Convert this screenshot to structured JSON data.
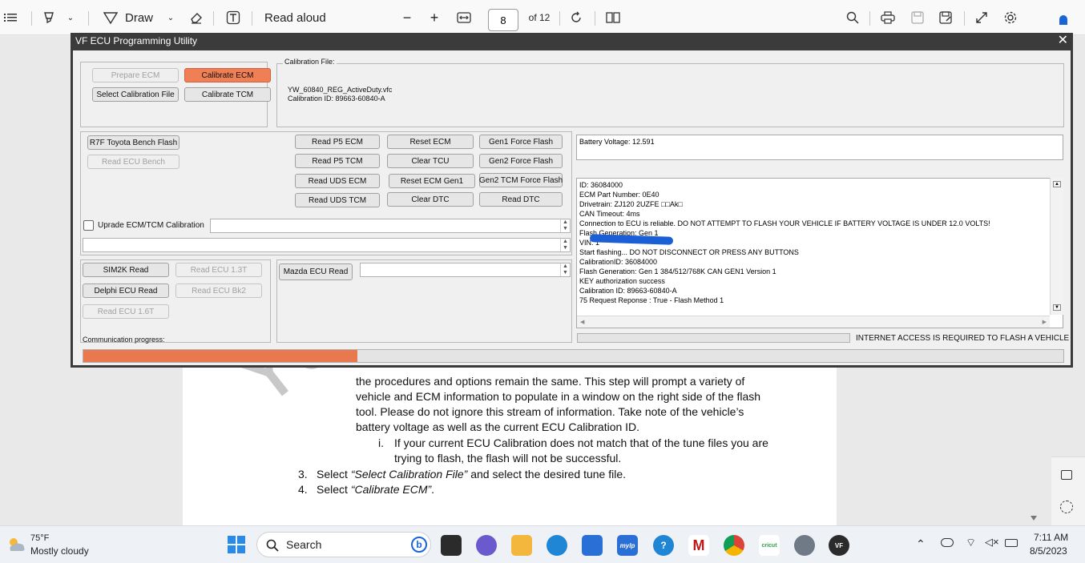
{
  "toolbar": {
    "draw_label": "Draw",
    "read_aloud_label": "Read aloud",
    "minus": "−",
    "plus": "+",
    "page_current": "8",
    "page_total": "of 12"
  },
  "pdf": {
    "watermark": "Yo",
    "lines": [
      "the procedures and options remain the same. This step will prompt a variety of",
      "vehicle and ECM information to populate in a window on the right side of the flash",
      "tool. Please do not ignore this stream of information. Take note of the vehicle’s",
      "battery voltage as well as the current ECU Calibration ID."
    ],
    "sub_marker": "i.",
    "sub_lines": [
      "If your current ECU Calibration does not match that of the tune files you are",
      "trying to flash, the flash will not be successful."
    ],
    "step3_num": "3.",
    "step3_pre": "Select ",
    "step3_em": "“Select Calibration File”",
    "step3_post": " and select the desired tune file.",
    "step4_num": "4.",
    "step4_pre": "Select ",
    "step4_em": "“Calibrate ECM”",
    "step4_post": "."
  },
  "dialog": {
    "title": "VF ECU Programming Utility",
    "close": "✕",
    "buttons": {
      "prepare_ecm": "Prepare ECM",
      "calibrate_ecm": "Calibrate ECM",
      "select_cal_file": "Select Calibration File",
      "calibrate_tcm": "Calibrate TCM",
      "r7f_flash": "R7F Toyota Bench Flash",
      "read_ecu_bench": "Read ECU Bench",
      "read_p5_ecm": "Read P5 ECM",
      "reset_ecm": "Reset ECM",
      "gen1_force": "Gen1 Force Flash",
      "read_p5_tcm": "Read P5 TCM",
      "clear_tcu": "Clear TCU",
      "gen2_force": "Gen2 Force Flash",
      "read_uds_ecm": "Read UDS ECM",
      "reset_ecm_gen1": "Reset ECM Gen1",
      "gen2_tcm_force": "Gen2 TCM Force Flash",
      "read_uds_tcm": "Read UDS TCM",
      "clear_dtc": "Clear DTC",
      "read_dtc": "Read DTC",
      "sim2k_read": "SIM2K Read",
      "read_ecu_13t": "Read ECU 1.3T",
      "delphi_read": "Delphi ECU Read",
      "read_ecu_bk2": "Read ECU Bk2",
      "read_ecu_16t": "Read ECU 1.6T",
      "mazda_read": "Mazda ECU Read"
    },
    "calibration_file_label": "Calibration File:",
    "calibration_file_name": "YW_60840_REG_ActiveDuty.vfc",
    "calibration_id": "Calibration ID: 89663-60840-A",
    "upgrade_label": "Uprade ECM/TCM Calibration",
    "battery_voltage": "Battery Voltage: 12.591",
    "log": [
      "ID: 36084000",
      "ECM Part Number: 0E40",
      "Drivetrain: ZJ120 2UZFE □□Ak□",
      "CAN Timeout: 4ms",
      "Connection to ECU is reliable. DO NOT ATTEMPT TO FLASH YOUR VEHICLE IF BATTERY VOLTAGE IS UNDER 12.0 VOLTS!",
      "Flash Generation: Gen 1",
      "VIN: 1",
      "Start flashing... DO NOT DISCONNECT OR PRESS ANY BUTTONS",
      "CalibrationID: 36084000",
      "Flash Generation: Gen 1 384/512/768K CAN GEN1 Version 1",
      "KEY authorization success",
      "Calibration ID: 89663-60840-A",
      "75 Request Reponse : True - Flash Method 1"
    ],
    "internet_notice": "INTERNET ACCESS IS REQUIRED TO FLASH A VEHICLE",
    "comm_progress_label": "Communication progress:",
    "comm_progress": 0.28,
    "internet_progress": 0
  },
  "taskbar": {
    "weather_temp": "75°F",
    "weather_desc": "Mostly cloudy",
    "search": "Search",
    "time": "7:11 AM",
    "date": "8/5/2023",
    "app_labels": {
      "mylp": "mylp",
      "cricut": "cricut",
      "vf": "VF"
    }
  },
  "colors": {
    "accent_orange": "#f07f55",
    "progress_orange": "#e9784e",
    "dialog_title_bg": "#3b3b3b",
    "taskbar_bg": "#eef1f6"
  },
  "icons": [
    "list-icon",
    "highlight-icon",
    "draw-icon",
    "eraser-icon",
    "text-icon",
    "fit-width-icon",
    "rotate-icon",
    "two-page-icon",
    "search-icon",
    "print-icon",
    "save-icon",
    "save-as-icon",
    "expand-icon",
    "settings-icon",
    "windows-start-icon",
    "weather-icon"
  ]
}
